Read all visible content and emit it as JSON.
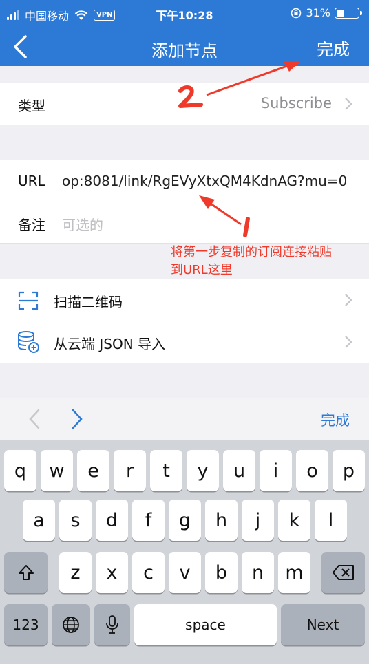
{
  "status_bar": {
    "carrier": "中国移动",
    "vpn": "VPN",
    "time": "下午10:28",
    "battery": "31%",
    "battery_level": 0.31
  },
  "nav": {
    "title": "添加节点",
    "done": "完成"
  },
  "form": {
    "type_label": "类型",
    "type_value": "Subscribe",
    "url_label": "URL",
    "url_value": "op:8081/link/RgEVyXtxQM4KdnAG?mu=0",
    "remark_label": "备注",
    "remark_placeholder": "可选的"
  },
  "annotation": {
    "text_line1": "将第一步复制的订阅连接粘贴",
    "text_line2": "到URL这里",
    "marker1": "1",
    "marker2": "2"
  },
  "actions": [
    {
      "label": "扫描二维码",
      "icon": "scan-icon"
    },
    {
      "label": "从云端 JSON 导入",
      "icon": "database-import-icon"
    }
  ],
  "keyboard": {
    "accessory_done": "完成",
    "row1": [
      "q",
      "w",
      "e",
      "r",
      "t",
      "y",
      "u",
      "i",
      "o",
      "p"
    ],
    "row2": [
      "a",
      "s",
      "d",
      "f",
      "g",
      "h",
      "j",
      "k",
      "l"
    ],
    "row3": [
      "z",
      "x",
      "c",
      "v",
      "b",
      "n",
      "m"
    ],
    "numbers": "123",
    "space": "space",
    "next": "Next"
  },
  "colors": {
    "accent": "#2c7ad6",
    "annotation": "#ef3a2b",
    "background": "#efeff4"
  }
}
